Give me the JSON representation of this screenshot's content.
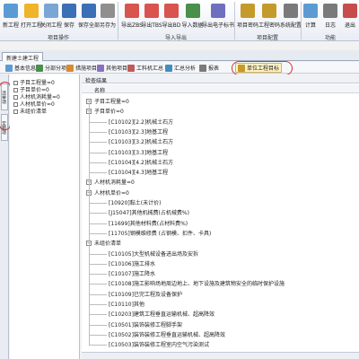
{
  "ribbon": {
    "buttons": [
      {
        "label": "新工程",
        "icon": "new-project-icon",
        "color": "#5b9bd5"
      },
      {
        "label": "打开工程",
        "icon": "open-folder-icon",
        "color": "#f0b429"
      },
      {
        "label": "关闭工程",
        "icon": "close-project-icon",
        "color": "#7aa6d6"
      },
      {
        "label": "保存",
        "icon": "save-icon",
        "color": "#3b6fb6"
      },
      {
        "label": "保存全部",
        "icon": "save-all-icon",
        "color": "#3b6fb6"
      },
      {
        "label": "另存为",
        "icon": "save-as-icon",
        "color": "#8f8f8f"
      },
      {
        "label": "导出ZBS",
        "icon": "export-zbs-icon",
        "color": "#d9534f"
      },
      {
        "label": "导出TBS",
        "icon": "export-tbs-icon",
        "color": "#d9534f"
      },
      {
        "label": "导出BD",
        "icon": "export-bd-icon",
        "color": "#d9534f"
      },
      {
        "label": "导入数据",
        "icon": "import-data-icon",
        "color": "#4a8f4a"
      },
      {
        "label": "导出电子标书",
        "icon": "export-ebid-icon",
        "color": "#6f6fbf"
      },
      {
        "label": "项目密码",
        "icon": "project-password-icon",
        "color": "#c49a2b"
      },
      {
        "label": "工程密码",
        "icon": "engineering-password-icon",
        "color": "#c49a2b"
      },
      {
        "label": "系统配置",
        "icon": "system-config-icon",
        "color": "#7a7a7a"
      },
      {
        "label": "计算",
        "icon": "calculate-icon",
        "color": "#5c9bd1"
      },
      {
        "label": "日志",
        "icon": "log-icon",
        "color": "#7a7a7a"
      },
      {
        "label": "退出",
        "icon": "exit-icon",
        "color": "#c84c4c"
      }
    ],
    "groups": [
      "项目操作",
      "导入导出",
      "项目配置",
      "功能"
    ]
  },
  "tab": {
    "label": "新建土建工程"
  },
  "toolbar": {
    "items": [
      {
        "label": "基本信息",
        "icon": "info-icon",
        "color": "#5b9bd5"
      },
      {
        "label": "分部分项",
        "icon": "subdivision-icon",
        "color": "#4a8f4a"
      },
      {
        "label": "措施项目",
        "icon": "measures-icon",
        "color": "#d98b2b"
      },
      {
        "label": "其他项目",
        "icon": "other-items-icon",
        "color": "#8b6fc0"
      },
      {
        "label": "工料机汇总",
        "icon": "labor-material-icon",
        "color": "#c05a5a"
      },
      {
        "label": "汇总分析",
        "icon": "summary-icon",
        "color": "#3f8fbf"
      },
      {
        "label": "报表",
        "icon": "report-icon",
        "color": "#7a7a7a"
      },
      {
        "label": "单位工程目标",
        "icon": "unit-target-icon",
        "color": "#c49a2b"
      }
    ]
  },
  "vtabs": [
    "清单项",
    "定额项"
  ],
  "leftpane": {
    "items": [
      "子目工程量=0",
      "子目单价=0",
      "人材机消耗量=0",
      "人材机单价=0",
      "未组价清单"
    ]
  },
  "rightpane": {
    "header": "检查结果",
    "column": "名称",
    "rows": [
      {
        "level": 0,
        "text": "子目工程量=0"
      },
      {
        "level": 0,
        "text": "子目单价=0"
      },
      {
        "level": 1,
        "text": "[C10102][2.2]机械土石方"
      },
      {
        "level": 1,
        "text": "[C10103][2.3]地基工程"
      },
      {
        "level": 1,
        "text": "[C10103][3.2]机械土石方"
      },
      {
        "level": 1,
        "text": "[C10103][3.3]地基工程"
      },
      {
        "level": 1,
        "text": "[C10104][4.2]机械土石方"
      },
      {
        "level": 1,
        "text": "[C10104][4.3]地基工程"
      },
      {
        "level": 0,
        "text": "人材机消耗量=0"
      },
      {
        "level": 0,
        "text": "人材机单价=0"
      },
      {
        "level": 1,
        "text": "[10920]黏土(未计价)"
      },
      {
        "level": 1,
        "text": "[J15047]其他机械费(占机械费%)"
      },
      {
        "level": 1,
        "text": "[11699]其他材料费(占材料费%)"
      },
      {
        "level": 1,
        "text": "[11705]钢模维修费 (占钢模、扣件、卡具)"
      },
      {
        "level": 0,
        "text": "未组价清单"
      },
      {
        "level": 1,
        "text": "[C10105]大型机械设备进出场及安拆"
      },
      {
        "level": 1,
        "text": "[C10106]施工排水"
      },
      {
        "level": 1,
        "text": "[C10107]施工降水"
      },
      {
        "level": 1,
        "text": "[C10108]施工影响场地周边地上、地下设施及建筑物安全的临时保护设施"
      },
      {
        "level": 1,
        "text": "[C10109]已完工程及设备保护"
      },
      {
        "level": 1,
        "text": "[C10110]其他"
      },
      {
        "level": 1,
        "text": "[C10203]建筑工程垂直运输机械、超高降效"
      },
      {
        "level": 1,
        "text": "[C10501]装饰装修工程脚手架"
      },
      {
        "level": 1,
        "text": "[C10502]装饰装修工程垂直运输机械、超高降效"
      },
      {
        "level": 1,
        "text": "[C10503]装饰装修工程室内空气污染测试"
      }
    ]
  }
}
